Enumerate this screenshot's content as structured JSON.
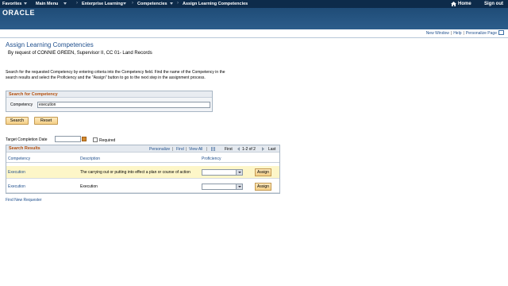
{
  "nav": {
    "items": [
      {
        "label": "Favorites"
      },
      {
        "label": "Main Menu"
      },
      {
        "label": "Enterprise Learning"
      },
      {
        "label": "Competencies"
      },
      {
        "label": "Assign Learning Competencies"
      }
    ],
    "home_label": "Home",
    "signout_label": "Sign out"
  },
  "brand": {
    "logo": "ORACLE"
  },
  "page_links": {
    "new_window": "New Window",
    "help": "Help",
    "personalize_page": "Personalize Page"
  },
  "page": {
    "title": "Assign Learning Competencies",
    "subtitle": "By request of CONNIE GREEN, Supervisor II, CC 01- Land Records",
    "instructions": "Search for the requested Competency by entering criteria into the Competency field. Find the name of the Competency in the search results and select the Proficiency and the \"Assign\" button to go to the next step in the assignment process."
  },
  "search": {
    "header": "Search for Competency",
    "competency_label": "Competency",
    "competency_value": "execution",
    "search_button": "Search",
    "reset_button": "Reset"
  },
  "target": {
    "label": "Target Completion Date",
    "required_label": "Required"
  },
  "results": {
    "header": "Search Results",
    "personalize": "Personalize",
    "find": "Find",
    "view_all": "View All",
    "first": "First",
    "range": "1-2 of 2",
    "last": "Last",
    "columns": {
      "competency": "Competency",
      "description": "Description",
      "proficiency": "Proficiency"
    },
    "rows": [
      {
        "competency": "Execution",
        "description": "The carrying out or putting into effect a plan or course of action",
        "proficiency": "",
        "assign": "Assign"
      },
      {
        "competency": "Execution",
        "description": "Execution",
        "proficiency": "",
        "assign": "Assign"
      }
    ]
  },
  "footer": {
    "find_new_requester": "Find New Requester"
  },
  "colors": {
    "nav_bg": "#0d2b4a",
    "brand_bar": "#2c5d8b",
    "link": "#1f4f8d",
    "section_header": "#b24d0a",
    "highlight_row": "#fdf6c8",
    "button": "#f5cf86"
  }
}
